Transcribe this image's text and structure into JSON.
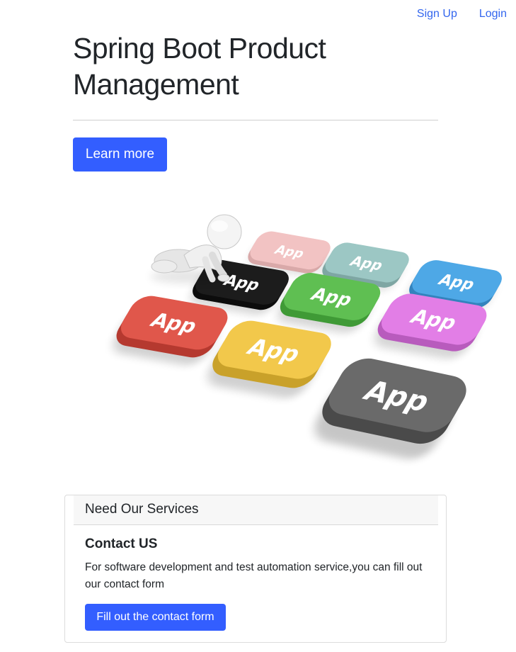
{
  "nav": {
    "signup_label": "Sign Up",
    "login_label": "Login"
  },
  "hero": {
    "title": "Spring Boot Product Management",
    "learn_more_label": "Learn more"
  },
  "illustration": {
    "tile_label": "App",
    "tile_colors": [
      "#f2c3c3",
      "#9cc7c4",
      "#4ea8e6",
      "#1c1c1c",
      "#5fbf52",
      "#e27ee6",
      "#e0574b",
      "#f2c84b",
      "#6a6a6a"
    ]
  },
  "card": {
    "header": "Need Our Services",
    "title": "Contact US",
    "text": "For software development and test automation service,you can fill out our contact form",
    "button_label": "Fill out the contact form"
  },
  "colors": {
    "primary": "#335eff",
    "link": "#3366ee"
  }
}
